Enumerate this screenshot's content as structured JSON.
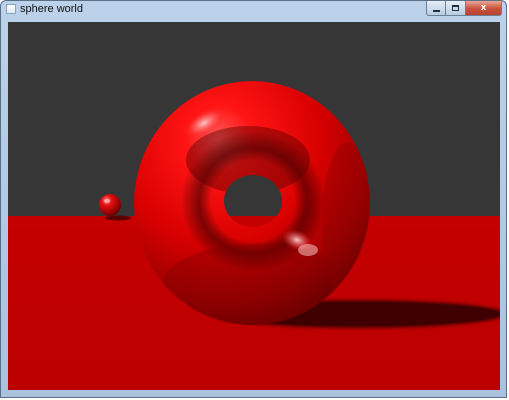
{
  "window": {
    "title": "sphere world",
    "close_glyph": "x"
  },
  "icons": {
    "app": "window-app-icon",
    "minimize": "minimize-icon",
    "maximize": "maximize-icon",
    "close": "close-icon"
  },
  "colors": {
    "sky": "#363636",
    "floor": "#c00000",
    "torus": "#e00000",
    "shadow": "#4a0000"
  }
}
